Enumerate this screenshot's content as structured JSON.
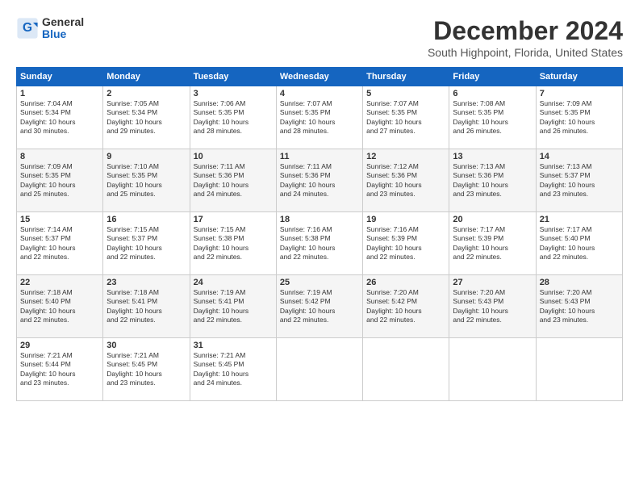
{
  "header": {
    "logo": {
      "line1": "General",
      "line2": "Blue"
    },
    "title": "December 2024",
    "location": "South Highpoint, Florida, United States"
  },
  "calendar": {
    "days_of_week": [
      "Sunday",
      "Monday",
      "Tuesday",
      "Wednesday",
      "Thursday",
      "Friday",
      "Saturday"
    ],
    "weeks": [
      [
        {
          "day": "1",
          "info": "Sunrise: 7:04 AM\nSunset: 5:34 PM\nDaylight: 10 hours\nand 30 minutes."
        },
        {
          "day": "2",
          "info": "Sunrise: 7:05 AM\nSunset: 5:34 PM\nDaylight: 10 hours\nand 29 minutes."
        },
        {
          "day": "3",
          "info": "Sunrise: 7:06 AM\nSunset: 5:35 PM\nDaylight: 10 hours\nand 28 minutes."
        },
        {
          "day": "4",
          "info": "Sunrise: 7:07 AM\nSunset: 5:35 PM\nDaylight: 10 hours\nand 28 minutes."
        },
        {
          "day": "5",
          "info": "Sunrise: 7:07 AM\nSunset: 5:35 PM\nDaylight: 10 hours\nand 27 minutes."
        },
        {
          "day": "6",
          "info": "Sunrise: 7:08 AM\nSunset: 5:35 PM\nDaylight: 10 hours\nand 26 minutes."
        },
        {
          "day": "7",
          "info": "Sunrise: 7:09 AM\nSunset: 5:35 PM\nDaylight: 10 hours\nand 26 minutes."
        }
      ],
      [
        {
          "day": "8",
          "info": "Sunrise: 7:09 AM\nSunset: 5:35 PM\nDaylight: 10 hours\nand 25 minutes."
        },
        {
          "day": "9",
          "info": "Sunrise: 7:10 AM\nSunset: 5:35 PM\nDaylight: 10 hours\nand 25 minutes."
        },
        {
          "day": "10",
          "info": "Sunrise: 7:11 AM\nSunset: 5:36 PM\nDaylight: 10 hours\nand 24 minutes."
        },
        {
          "day": "11",
          "info": "Sunrise: 7:11 AM\nSunset: 5:36 PM\nDaylight: 10 hours\nand 24 minutes."
        },
        {
          "day": "12",
          "info": "Sunrise: 7:12 AM\nSunset: 5:36 PM\nDaylight: 10 hours\nand 23 minutes."
        },
        {
          "day": "13",
          "info": "Sunrise: 7:13 AM\nSunset: 5:36 PM\nDaylight: 10 hours\nand 23 minutes."
        },
        {
          "day": "14",
          "info": "Sunrise: 7:13 AM\nSunset: 5:37 PM\nDaylight: 10 hours\nand 23 minutes."
        }
      ],
      [
        {
          "day": "15",
          "info": "Sunrise: 7:14 AM\nSunset: 5:37 PM\nDaylight: 10 hours\nand 22 minutes."
        },
        {
          "day": "16",
          "info": "Sunrise: 7:15 AM\nSunset: 5:37 PM\nDaylight: 10 hours\nand 22 minutes."
        },
        {
          "day": "17",
          "info": "Sunrise: 7:15 AM\nSunset: 5:38 PM\nDaylight: 10 hours\nand 22 minutes."
        },
        {
          "day": "18",
          "info": "Sunrise: 7:16 AM\nSunset: 5:38 PM\nDaylight: 10 hours\nand 22 minutes."
        },
        {
          "day": "19",
          "info": "Sunrise: 7:16 AM\nSunset: 5:39 PM\nDaylight: 10 hours\nand 22 minutes."
        },
        {
          "day": "20",
          "info": "Sunrise: 7:17 AM\nSunset: 5:39 PM\nDaylight: 10 hours\nand 22 minutes."
        },
        {
          "day": "21",
          "info": "Sunrise: 7:17 AM\nSunset: 5:40 PM\nDaylight: 10 hours\nand 22 minutes."
        }
      ],
      [
        {
          "day": "22",
          "info": "Sunrise: 7:18 AM\nSunset: 5:40 PM\nDaylight: 10 hours\nand 22 minutes."
        },
        {
          "day": "23",
          "info": "Sunrise: 7:18 AM\nSunset: 5:41 PM\nDaylight: 10 hours\nand 22 minutes."
        },
        {
          "day": "24",
          "info": "Sunrise: 7:19 AM\nSunset: 5:41 PM\nDaylight: 10 hours\nand 22 minutes."
        },
        {
          "day": "25",
          "info": "Sunrise: 7:19 AM\nSunset: 5:42 PM\nDaylight: 10 hours\nand 22 minutes."
        },
        {
          "day": "26",
          "info": "Sunrise: 7:20 AM\nSunset: 5:42 PM\nDaylight: 10 hours\nand 22 minutes."
        },
        {
          "day": "27",
          "info": "Sunrise: 7:20 AM\nSunset: 5:43 PM\nDaylight: 10 hours\nand 22 minutes."
        },
        {
          "day": "28",
          "info": "Sunrise: 7:20 AM\nSunset: 5:43 PM\nDaylight: 10 hours\nand 23 minutes."
        }
      ],
      [
        {
          "day": "29",
          "info": "Sunrise: 7:21 AM\nSunset: 5:44 PM\nDaylight: 10 hours\nand 23 minutes."
        },
        {
          "day": "30",
          "info": "Sunrise: 7:21 AM\nSunset: 5:45 PM\nDaylight: 10 hours\nand 23 minutes."
        },
        {
          "day": "31",
          "info": "Sunrise: 7:21 AM\nSunset: 5:45 PM\nDaylight: 10 hours\nand 24 minutes."
        },
        {
          "day": "",
          "info": ""
        },
        {
          "day": "",
          "info": ""
        },
        {
          "day": "",
          "info": ""
        },
        {
          "day": "",
          "info": ""
        }
      ]
    ]
  }
}
